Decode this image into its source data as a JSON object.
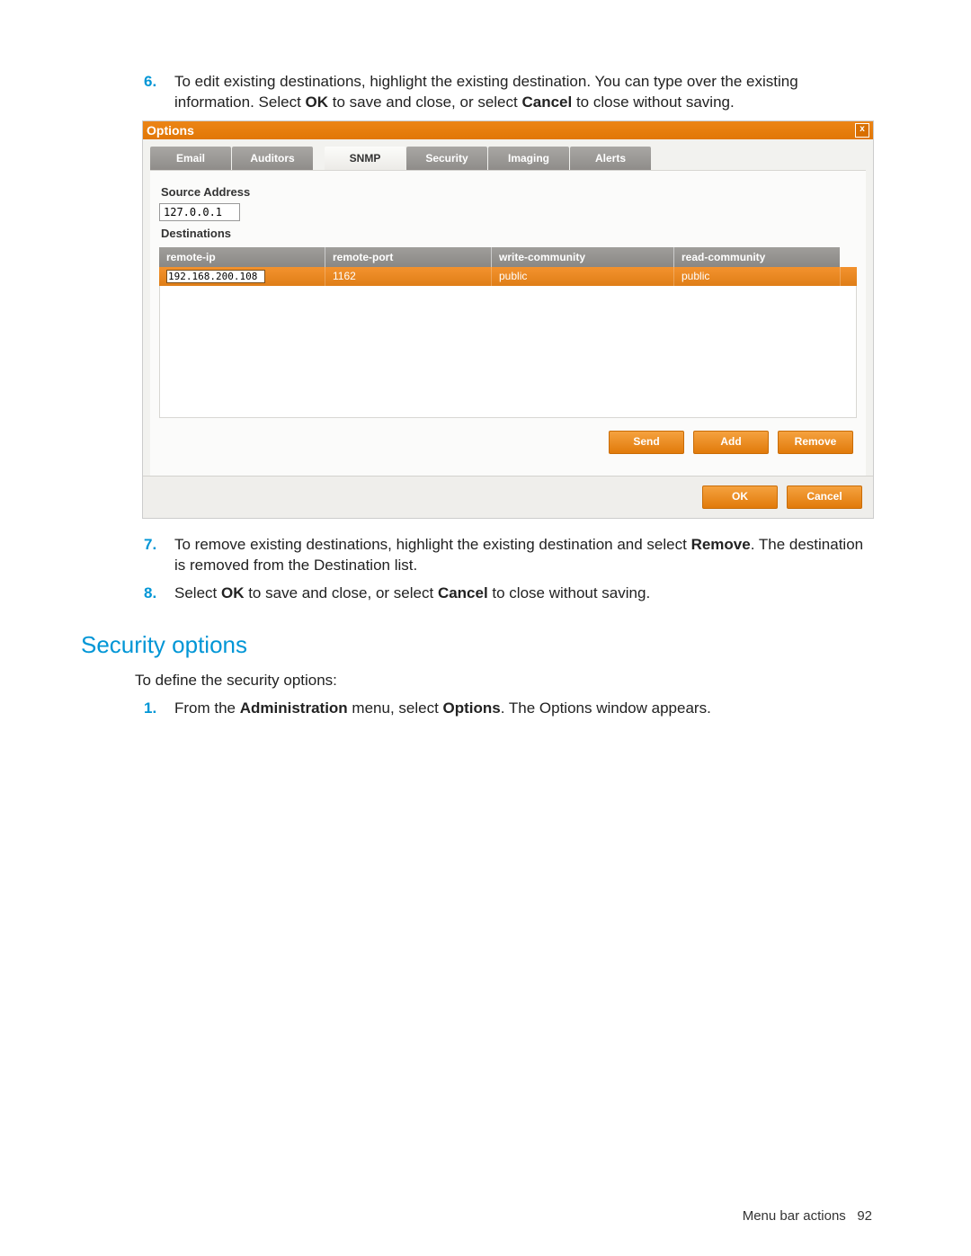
{
  "steps": {
    "s6": {
      "num": "6.",
      "text_a": "To edit existing destinations, highlight the existing destination. You can type over the existing information. Select ",
      "b1": "OK",
      "text_b": " to save and close, or select ",
      "b2": "Cancel",
      "text_c": " to close without saving."
    },
    "s7": {
      "num": "7.",
      "text_a": "To remove existing destinations, highlight the existing destination and select ",
      "b1": "Remove",
      "text_b": ". The destination is removed from the Destination list."
    },
    "s8": {
      "num": "8.",
      "text_a": "Select ",
      "b1": "OK",
      "text_b": " to save and close, or select ",
      "b2": "Cancel",
      "text_c": " to close without saving."
    }
  },
  "dialog": {
    "title": "Options",
    "tabs": [
      "Email",
      "Auditors",
      "SNMP",
      "Security",
      "Imaging",
      "Alerts"
    ],
    "source_label": "Source Address",
    "source_value": "127.0.0.1",
    "dest_label": "Destinations",
    "columns": [
      "remote-ip",
      "remote-port",
      "write-community",
      "read-community"
    ],
    "row": {
      "remote_ip": "192.168.200.108",
      "remote_port": "1162",
      "write": "public",
      "read": "public"
    },
    "actions": {
      "send": "Send",
      "add": "Add",
      "remove": "Remove",
      "ok": "OK",
      "cancel": "Cancel"
    }
  },
  "heading": "Security options",
  "intro": "To define the security options:",
  "s1": {
    "num": "1.",
    "a": "From the ",
    "b1": "Administration",
    "b": " menu, select ",
    "b2": "Options",
    "c": ". The Options window appears."
  },
  "footer": {
    "label": "Menu bar actions",
    "page": "92"
  }
}
